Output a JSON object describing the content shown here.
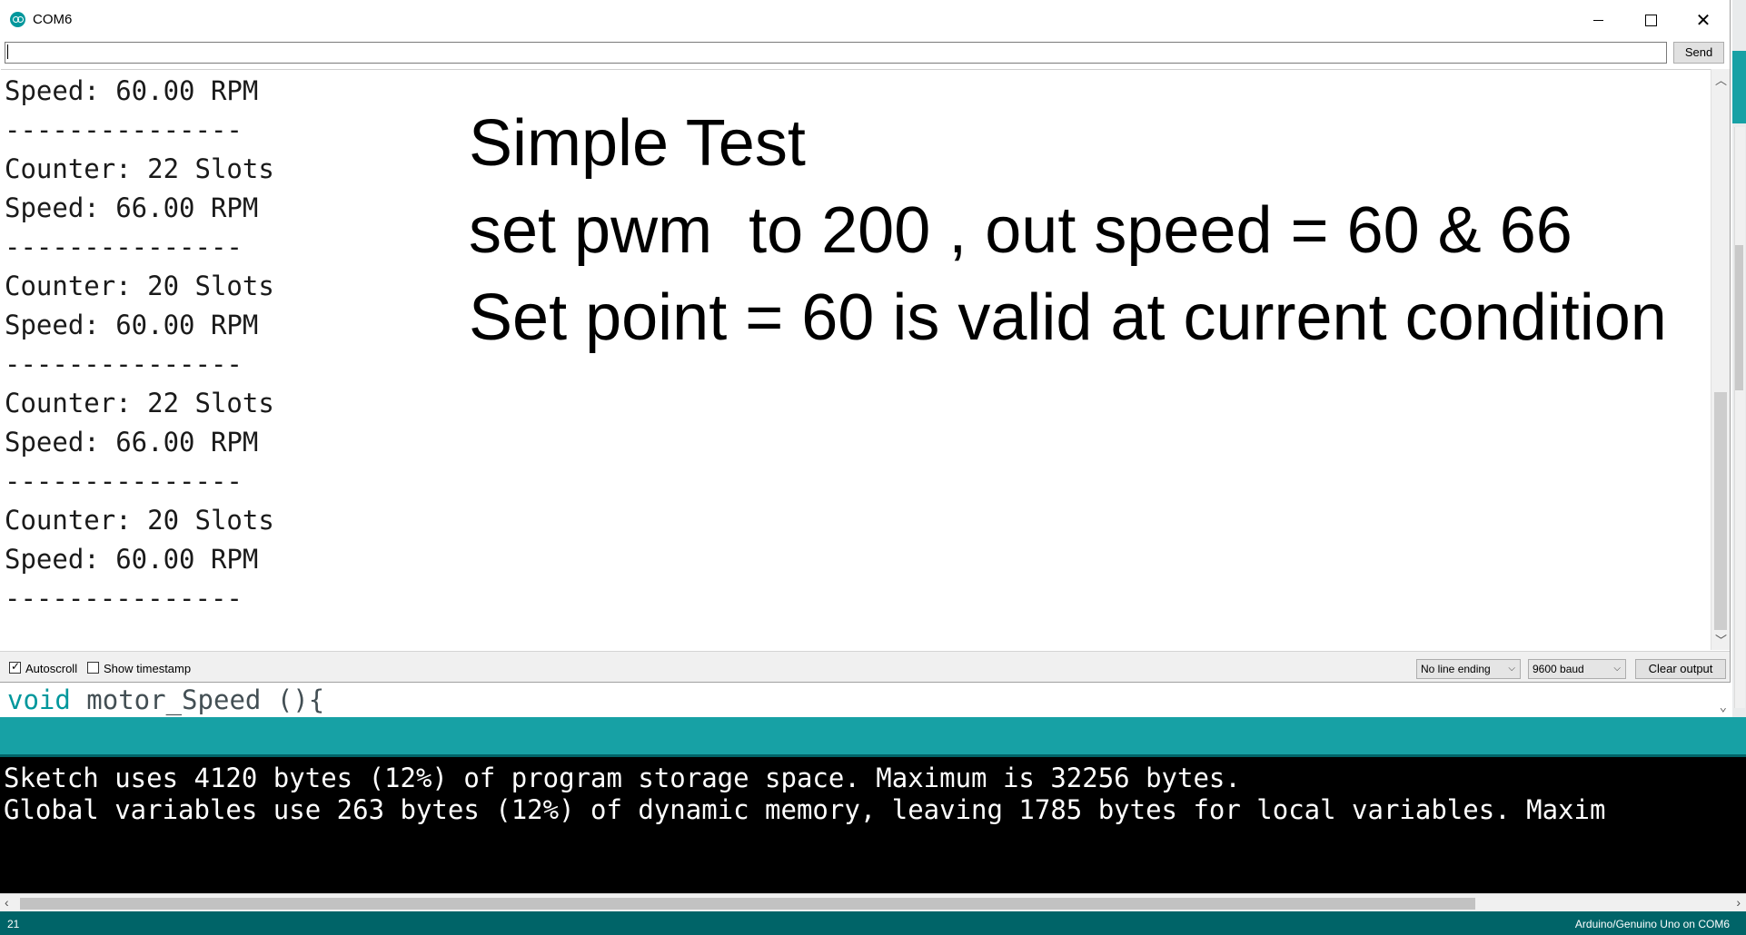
{
  "window": {
    "title": "COM6"
  },
  "send": {
    "value": "",
    "button_label": "Send"
  },
  "output": [
    "Speed: 60.00 RPM",
    "---------------",
    "Counter: 22 Slots",
    "Speed: 66.00 RPM",
    "---------------",
    "Counter: 20 Slots",
    "Speed: 60.00 RPM",
    "---------------",
    "Counter: 22 Slots",
    "Speed: 66.00 RPM",
    "---------------",
    "Counter: 20 Slots",
    "Speed: 60.00 RPM",
    "---------------"
  ],
  "annotation": [
    "Simple Test",
    "set pwm  to 200 , out speed = 60 & 66",
    "Set point = 60 is valid at current condition"
  ],
  "bottom_bar": {
    "autoscroll_label": "Autoscroll",
    "autoscroll_checked": true,
    "timestamp_label": "Show timestamp",
    "timestamp_checked": false,
    "line_ending": "No line ending",
    "baud": "9600 baud",
    "clear_label": "Clear output"
  },
  "editor": {
    "keyword": "void",
    "rest": " motor_Speed (){"
  },
  "console": [
    "Sketch uses 4120 bytes (12%) of program storage space. Maximum is 32256 bytes.",
    "Global variables use 263 bytes (12%) of dynamic memory, leaving 1785 bytes for local variables. Maxim"
  ],
  "status": {
    "line": "21",
    "board": "Arduino/Genuino Uno on COM6"
  },
  "icons": [
    "arduino-app-icon",
    "minimize-icon",
    "maximize-icon",
    "close-icon",
    "scroll-up-icon",
    "scroll-down-icon",
    "scroll-left-icon",
    "scroll-right-icon",
    "chevron-down-icon"
  ],
  "colors": {
    "ide_teal": "#17a1a5",
    "ide_dark_teal": "#006468",
    "console_bg": "#000000",
    "keyword": "#00979c"
  }
}
